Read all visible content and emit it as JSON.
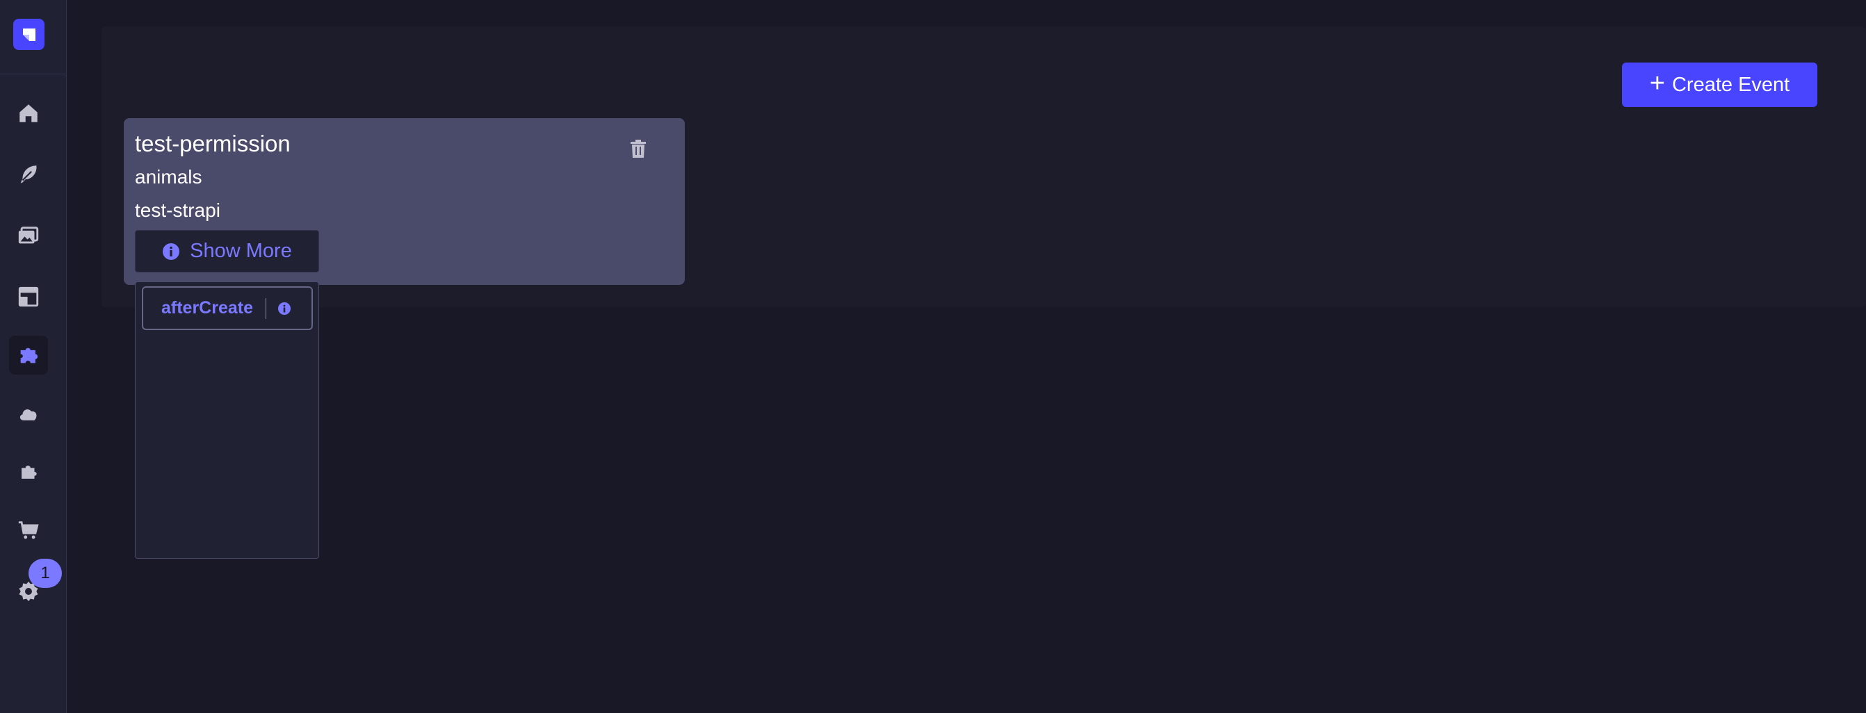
{
  "sidebar": {
    "logo": "strapi-logo-icon",
    "items": [
      {
        "icon": "home-icon"
      },
      {
        "icon": "feather-icon"
      },
      {
        "icon": "media-library-icon"
      },
      {
        "icon": "layout-icon"
      },
      {
        "icon": "puzzle-icon",
        "active": true
      },
      {
        "icon": "cloud-icon"
      },
      {
        "icon": "plugins-icon"
      },
      {
        "icon": "cart-icon"
      },
      {
        "icon": "gear-icon"
      }
    ],
    "settings_badge": "1"
  },
  "header": {
    "create_label": "Create Event"
  },
  "event": {
    "name": "test-permission",
    "line1": "animals",
    "line2": "test-strapi",
    "show_more_label": "Show More",
    "hooks": [
      "afterCreate"
    ]
  },
  "colors": {
    "accent": "#4945ff",
    "accent_text": "#7b79ff",
    "background": "#181826",
    "card": "#4a4a6a"
  }
}
